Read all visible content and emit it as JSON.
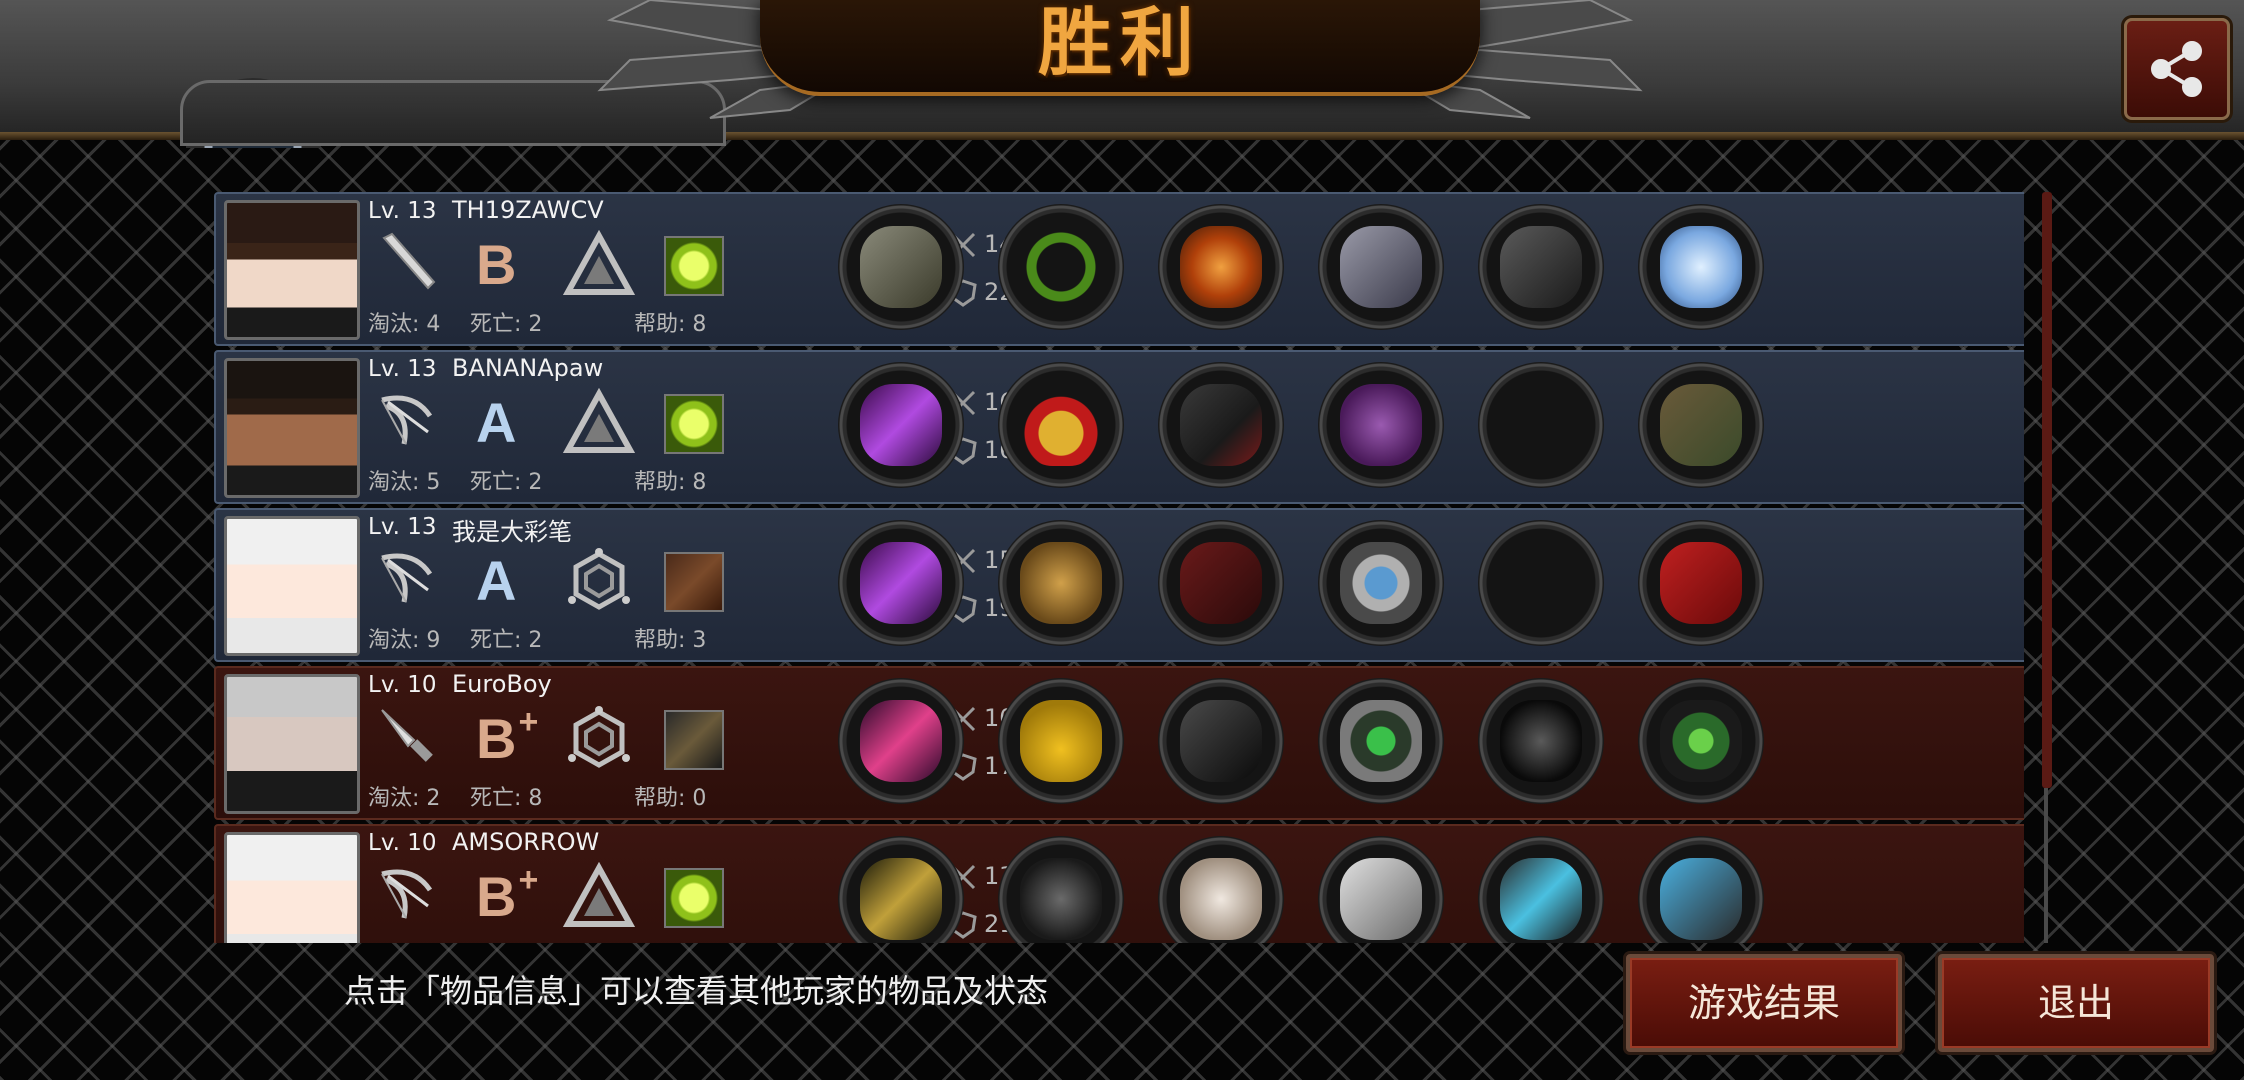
{
  "header": {
    "title": "胜利",
    "name_bar_text": ""
  },
  "players": [
    {
      "level": "Lv. 13",
      "name": "TH19ZAWCV",
      "grade": "B",
      "grade_plus": "",
      "kills": "淘汰: 4",
      "deaths": "死亡: 2",
      "assists": "帮助: 8",
      "attack": "141",
      "defense": "229",
      "team": "blue",
      "weapon_icon": "bat-icon",
      "rank_icon": "triangle-rank-icon",
      "skill_icon": "green-orb-skill-icon",
      "items": [
        "gatling-gun-icon",
        "laurel-wreath-icon",
        "flaming-armor-icon",
        "spiked-gauntlet-icon",
        "combat-boots-icon",
        "ice-crystal-icon"
      ]
    },
    {
      "level": "Lv. 13",
      "name": "BANANApaw",
      "grade": "A",
      "grade_plus": "",
      "kills": "淘汰: 5",
      "deaths": "死亡: 2",
      "assists": "帮助: 8",
      "attack": "163",
      "defense": "168",
      "team": "blue",
      "weapon_icon": "bow-icon",
      "rank_icon": "triangle-rank-icon",
      "skill_icon": "green-orb-skill-icon",
      "items": [
        "purple-bow-icon",
        "royal-crown-icon",
        "dark-coat-icon",
        "purple-gauntlet-icon",
        "empty-slot",
        "quiver-icon"
      ]
    },
    {
      "level": "Lv. 13",
      "name": "我是大彩笔",
      "grade": "A",
      "grade_plus": "",
      "kills": "淘汰: 9",
      "deaths": "死亡: 2",
      "assists": "帮助: 3",
      "attack": "156",
      "defense": "198",
      "team": "blue",
      "weapon_icon": "bow-icon",
      "rank_icon": "hexagon-rank-icon",
      "skill_icon": "crossed-blades-skill-icon",
      "items": [
        "purple-bow-icon",
        "knight-helmet-icon",
        "red-armor-icon",
        "digital-watch-icon",
        "empty-slot",
        "red-quiver-icon"
      ]
    },
    {
      "level": "Lv. 10",
      "name": "EuroBoy",
      "grade": "B",
      "grade_plus": "+",
      "kills": "淘汰: 2",
      "deaths": "死亡: 8",
      "assists": "帮助: 0",
      "attack": "103",
      "defense": "171",
      "team": "red",
      "weapon_icon": "knife-icon",
      "rank_icon": "hexagon-rank-icon",
      "skill_icon": "dark-figure-skill-icon",
      "items": [
        "pink-dagger-icon",
        "hard-hat-icon",
        "black-suit-icon",
        "radar-device-icon",
        "knee-pad-icon",
        "green-emblem-icon"
      ]
    },
    {
      "level": "Lv. 10",
      "name": "AMSORROW",
      "grade": "B",
      "grade_plus": "+",
      "kills": "",
      "deaths": "",
      "assists": "",
      "attack": "138",
      "defense": "218",
      "team": "red",
      "weapon_icon": "bow-icon",
      "rank_icon": "triangle-rank-icon",
      "skill_icon": "green-orb-skill-icon",
      "items": [
        "golden-bow-icon",
        "tactical-helmet-icon",
        "white-armor-icon",
        "silver-gauntlet-icon",
        "sneakers-icon",
        "blue-quiver-icon"
      ]
    }
  ],
  "footer": {
    "tip": "点击「物品信息」可以查看其他玩家的物品及状态",
    "result_button": "游戏结果",
    "exit_button": "退出"
  },
  "colors": {
    "title": "#f0a640",
    "blue_team": "#2b3445",
    "red_team": "#3b1510",
    "button": "#7a1e12"
  }
}
